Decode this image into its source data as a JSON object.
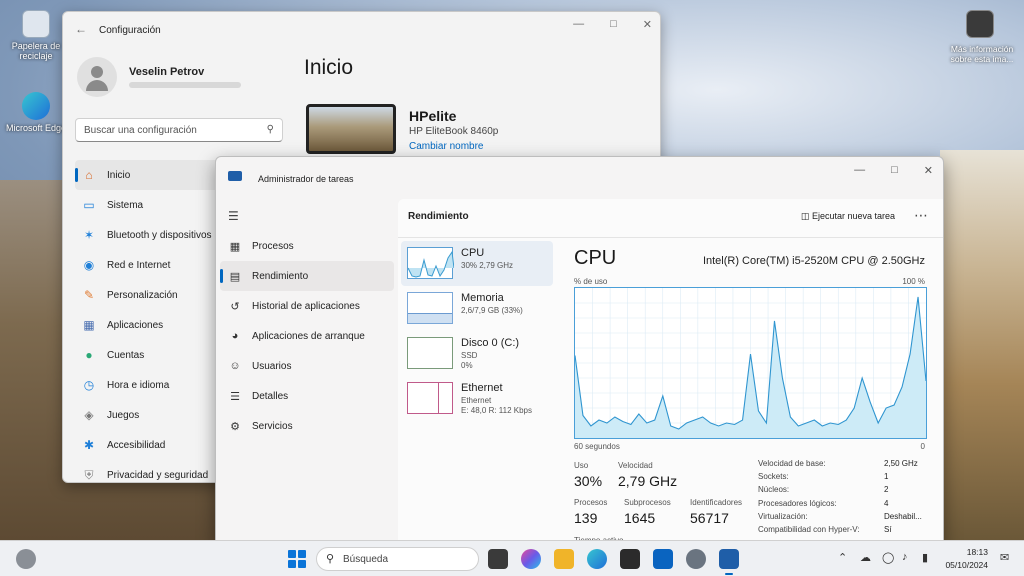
{
  "desktop": {
    "icons": [
      {
        "label": "Papelera de reciclaje"
      },
      {
        "label": "Microsoft Edge"
      }
    ],
    "info_label": "Más información sobre esta ima..."
  },
  "settings": {
    "title": "Configuración",
    "user_name": "Veselin Petrov",
    "search_placeholder": "Buscar una configuración",
    "page_title": "Inicio",
    "device_name": "HPelite",
    "device_model": "HP EliteBook 8460p",
    "rename_link": "Cambiar nombre",
    "nav": [
      {
        "label": "Inicio",
        "icon": "home-icon"
      },
      {
        "label": "Sistema",
        "icon": "monitor-icon"
      },
      {
        "label": "Bluetooth y dispositivos",
        "icon": "bluetooth-icon"
      },
      {
        "label": "Red e Internet",
        "icon": "wifi-icon"
      },
      {
        "label": "Personalización",
        "icon": "brush-icon"
      },
      {
        "label": "Aplicaciones",
        "icon": "apps-icon"
      },
      {
        "label": "Cuentas",
        "icon": "person-icon"
      },
      {
        "label": "Hora e idioma",
        "icon": "globe-clock-icon"
      },
      {
        "label": "Juegos",
        "icon": "gamepad-icon"
      },
      {
        "label": "Accesibilidad",
        "icon": "accessibility-icon"
      },
      {
        "label": "Privacidad y seguridad",
        "icon": "shield-icon"
      }
    ]
  },
  "taskmanager": {
    "title": "Administrador de tareas",
    "nav": [
      {
        "label": "Procesos",
        "icon": "grid-icon"
      },
      {
        "label": "Rendimiento",
        "icon": "performance-icon"
      },
      {
        "label": "Historial de aplicaciones",
        "icon": "history-icon"
      },
      {
        "label": "Aplicaciones de arranque",
        "icon": "gauge-icon"
      },
      {
        "label": "Usuarios",
        "icon": "users-icon"
      },
      {
        "label": "Detalles",
        "icon": "list-icon"
      },
      {
        "label": "Servicios",
        "icon": "puzzle-icon"
      }
    ],
    "header": "Rendimiento",
    "new_task": "Ejecutar nueva tarea",
    "resources": [
      {
        "name": "CPU",
        "sub": "30% 2,79 GHz"
      },
      {
        "name": "Memoria",
        "sub": "2,6/7,9 GB (33%)"
      },
      {
        "name": "Disco 0 (C:)",
        "sub": "SSD\n0%"
      },
      {
        "name": "Ethernet",
        "sub": "Ethernet\nE: 48,0 R: 112 Kbps"
      }
    ],
    "cpu_title": "CPU",
    "cpu_model": "Intel(R) Core(TM) i5-2520M CPU @ 2.50GHz",
    "graph_top_left": "% de uso",
    "graph_top_right": "100 %",
    "graph_bottom_left": "60 segundos",
    "graph_bottom_right": "0",
    "stats": {
      "uso_label": "Uso",
      "uso": "30%",
      "vel_label": "Velocidad",
      "vel": "2,79 GHz",
      "proc_label": "Procesos",
      "proc": "139",
      "subproc_label": "Subprocesos",
      "subproc": "1645",
      "ident_label": "Identificadores",
      "ident": "56717",
      "tiempo_label": "Tiempo activo"
    },
    "specs": [
      {
        "k": "Velocidad de base:",
        "v": "2,50 GHz"
      },
      {
        "k": "Sockets:",
        "v": "1"
      },
      {
        "k": "Núcleos:",
        "v": "2"
      },
      {
        "k": "Procesadores lógicos:",
        "v": "4"
      },
      {
        "k": "Virtualización:",
        "v": "Deshabil..."
      },
      {
        "k": "Compatibilidad con Hyper-V:",
        "v": "Sí"
      }
    ],
    "chart_data": {
      "type": "area",
      "ylim": [
        0,
        100
      ],
      "values": [
        55,
        15,
        8,
        12,
        10,
        14,
        11,
        9,
        16,
        10,
        12,
        28,
        8,
        6,
        10,
        12,
        14,
        10,
        8,
        10,
        9,
        12,
        56,
        18,
        10,
        78,
        40,
        14,
        8,
        10,
        12,
        8,
        10,
        9,
        12,
        20,
        40,
        24,
        10,
        20,
        22,
        34,
        56,
        94,
        38
      ]
    }
  },
  "taskbar": {
    "search": "Búsqueda",
    "time": "18:13",
    "date": "05/10/2024"
  }
}
